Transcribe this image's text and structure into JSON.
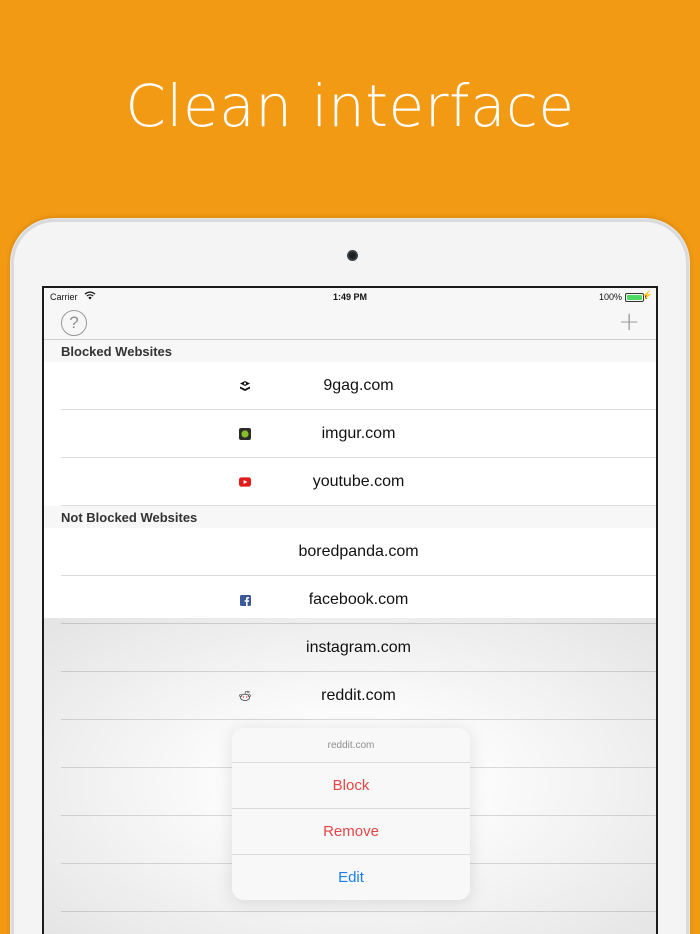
{
  "headline": "Clean interface",
  "status_bar": {
    "carrier": "Carrier",
    "time": "1:49 PM",
    "battery": "100%"
  },
  "nav": {
    "help_icon_glyph": "?",
    "add_icon_glyph": "+"
  },
  "sections": [
    {
      "title": "Blocked Websites",
      "rows": [
        {
          "label": "9gag.com",
          "icon": "9gag-icon"
        },
        {
          "label": "imgur.com",
          "icon": "imgur-icon"
        },
        {
          "label": "youtube.com",
          "icon": "youtube-icon"
        }
      ]
    },
    {
      "title": "Not Blocked Websites",
      "rows": [
        {
          "label": "boredpanda.com",
          "icon": ""
        },
        {
          "label": "facebook.com",
          "icon": "facebook-icon"
        },
        {
          "label": "instagram.com",
          "icon": ""
        },
        {
          "label": "reddit.com",
          "icon": "reddit-icon"
        }
      ]
    }
  ],
  "action_sheet": {
    "title": "reddit.com",
    "actions": [
      {
        "label": "Block",
        "style": "destructive"
      },
      {
        "label": "Remove",
        "style": "destructive"
      },
      {
        "label": "Edit",
        "style": "default"
      }
    ]
  },
  "colors": {
    "background": "#F29A13",
    "destructive": "#E64646",
    "default_action": "#1B7CF2"
  }
}
